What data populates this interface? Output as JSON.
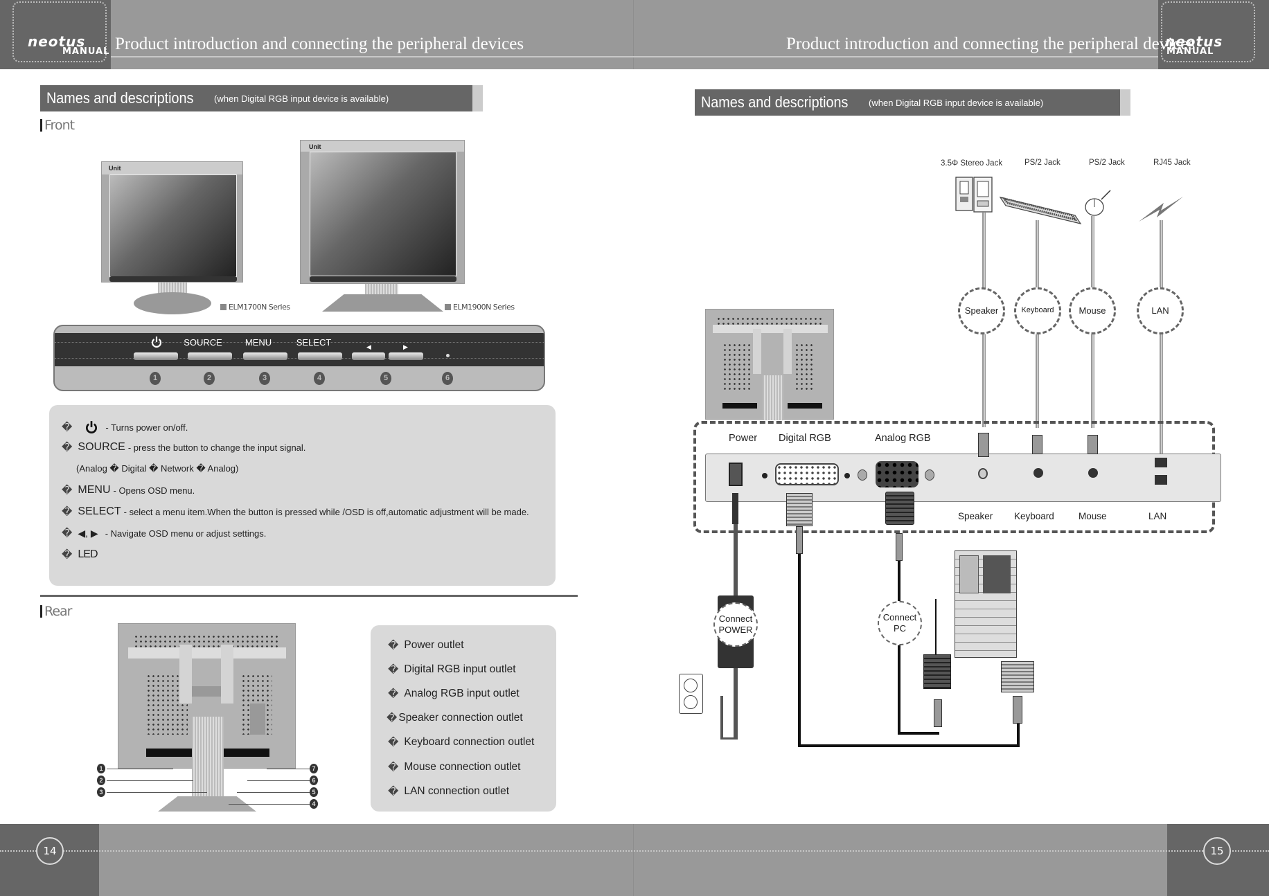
{
  "header": {
    "logo_line1": "neotus",
    "logo_line2": "MANUAL",
    "title_left": "Product introduction and connecting the peripheral devices",
    "title_right": "Product introduction and connecting the peripheral devices"
  },
  "left_page": {
    "section_title": "Names and descriptions",
    "section_subtitle": "(when Digital RGB input device is available)",
    "front_label": "Front",
    "monitors": [
      {
        "brand": "Unit",
        "caption": "ELM1700N Series"
      },
      {
        "brand": "Unit",
        "caption": "ELM1900N Series"
      }
    ],
    "control_panel": {
      "buttons": [
        {
          "label": "",
          "icon": "power-icon",
          "number": "1"
        },
        {
          "label": "SOURCE",
          "number": "2"
        },
        {
          "label": "MENU",
          "number": "3"
        },
        {
          "label": "SELECT",
          "number": "4"
        },
        {
          "label": "◀ ▶",
          "icon": "arrow-left-right-icon",
          "number": "5"
        },
        {
          "label": "",
          "icon": "led-icon",
          "number": "6"
        }
      ]
    },
    "front_descriptions": [
      {
        "bullet": "�",
        "key": "⏻",
        "text": "- Turns power on/off."
      },
      {
        "bullet": "�",
        "key": "SOURCE",
        "text": "- press the button to change the input signal."
      },
      {
        "bullet": "",
        "key": "",
        "text": "(Analog  � Digital � Network � Analog)"
      },
      {
        "bullet": "�",
        "key": "MENU",
        "text": "- Opens OSD menu."
      },
      {
        "bullet": "�",
        "key": "SELECT",
        "text": "- select a menu item.When the button is pressed while /OSD is off,automatic adjustment will be made."
      },
      {
        "bullet": "�",
        "key": "◀,  ▶",
        "text": "- Navigate OSD menu or adjust settings."
      },
      {
        "bullet": "�",
        "key": "LED",
        "text": ""
      }
    ],
    "rear_label": "Rear",
    "rear_callouts": [
      "1",
      "2",
      "3",
      "4",
      "5",
      "6",
      "7"
    ],
    "rear_descriptions": [
      {
        "bullet": "�",
        "text": "Power outlet"
      },
      {
        "bullet": "�",
        "text": "Digital RGB input outlet"
      },
      {
        "bullet": "�",
        "text": "Analog RGB input outlet"
      },
      {
        "bullet": "�",
        "text": "Speaker connection outlet"
      },
      {
        "bullet": "�",
        "text": "Keyboard connection outlet"
      },
      {
        "bullet": "�",
        "text": "Mouse connection outlet"
      },
      {
        "bullet": "�",
        "text": "LAN connection outlet"
      }
    ],
    "page_number": "14"
  },
  "right_page": {
    "section_title": "Names and descriptions",
    "section_subtitle": "(when Digital RGB input device is available)",
    "jacks": [
      {
        "label": "3.5Φ Stereo Jack",
        "device": "Speaker",
        "icon": "speaker-icon"
      },
      {
        "label": "PS/2 Jack",
        "device": "Keyboard",
        "icon": "keyboard-icon"
      },
      {
        "label": "PS/2 Jack",
        "device": "Mouse",
        "icon": "mouse-icon"
      },
      {
        "label": "RJ45 Jack",
        "device": "LAN",
        "icon": "lightning-icon"
      }
    ],
    "panel_top_labels": [
      "Power",
      "Digital RGB",
      "Analog RGB"
    ],
    "panel_bottom_labels": [
      "Speaker",
      "Keyboard",
      "Mouse",
      "LAN"
    ],
    "connect_power": "Connect\nPOWER",
    "connect_power_l1": "Connect",
    "connect_power_l2": "POWER",
    "connect_pc_l1": "Connect",
    "connect_pc_l2": "PC",
    "page_number": "15"
  }
}
